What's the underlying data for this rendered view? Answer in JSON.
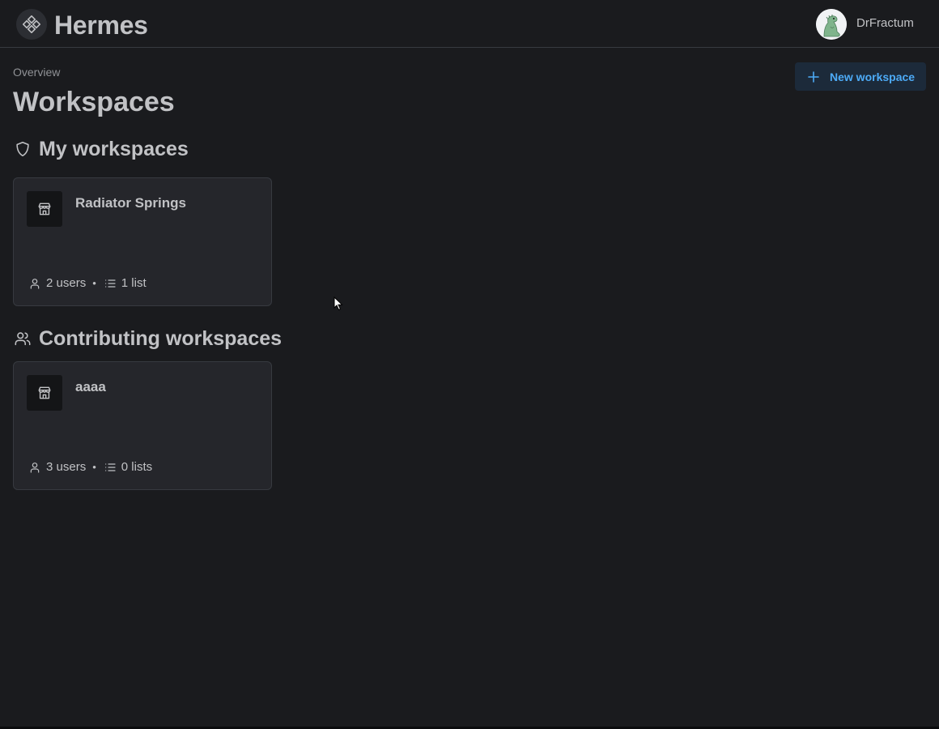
{
  "header": {
    "app_name": "Hermes",
    "user": {
      "name": "DrFractum"
    }
  },
  "page": {
    "breadcrumb": "Overview",
    "title": "Workspaces",
    "new_button_label": "New workspace"
  },
  "sections": {
    "mine": {
      "title": "My workspaces",
      "cards": [
        {
          "name": "Radiator Springs",
          "users": "2 users",
          "lists": "1 list"
        }
      ]
    },
    "contributing": {
      "title": "Contributing workspaces",
      "cards": [
        {
          "name": "aaaa",
          "users": "3 users",
          "lists": "0 lists"
        }
      ]
    }
  },
  "colors": {
    "background": "#1a1b1e",
    "card": "#25262b",
    "border": "#373a40",
    "accent": "#4dabf7",
    "text": "#c1c2c5",
    "muted": "#909296"
  },
  "icons": {
    "logo": "logo-icon",
    "new": "plus-icon",
    "mine": "shield-icon",
    "contributing": "users-icon",
    "workspace": "building-store-icon",
    "users_meta": "user-icon",
    "lists_meta": "list-icon"
  },
  "separator": "•"
}
